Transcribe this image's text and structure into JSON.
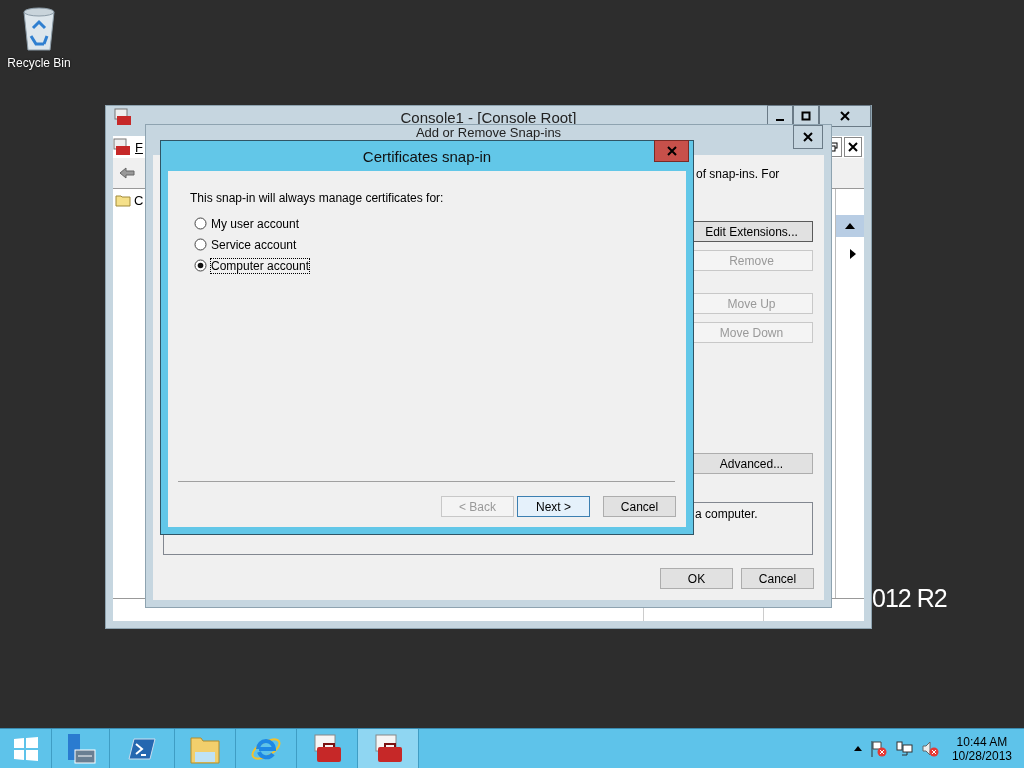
{
  "desktop": {
    "icons": [
      {
        "label": "Recycle Bin"
      }
    ],
    "watermark": "012 R2"
  },
  "console": {
    "title": "Console1 - [Console Root]",
    "menu_item": "F",
    "tree_item": "C"
  },
  "snapins_dialog": {
    "title": "Add or Remove Snap-ins",
    "intro": "of snap-ins. For",
    "buttons": [
      {
        "label": "Edit Extensions...",
        "disabled": false,
        "focused": true
      },
      {
        "label": "Remove",
        "disabled": true,
        "focused": false
      },
      {
        "label": "Move Up",
        "disabled": true,
        "focused": false
      },
      {
        "label": "Move Down",
        "disabled": true,
        "focused": false
      },
      {
        "label": "Advanced...",
        "disabled": false,
        "focused": false
      }
    ],
    "description": "a computer.",
    "footer_buttons": [
      "OK",
      "Cancel"
    ]
  },
  "cert_dialog": {
    "title": "Certificates snap-in",
    "prompt": "This snap-in will always manage certificates for:",
    "options": [
      {
        "label": "My user account",
        "selected": false
      },
      {
        "label": "Service account",
        "selected": false
      },
      {
        "label": "Computer account",
        "selected": true
      }
    ],
    "buttons": [
      {
        "label": "< Back",
        "disabled": true,
        "default": false
      },
      {
        "label": "Next >",
        "disabled": false,
        "default": true
      },
      {
        "label": "Cancel",
        "disabled": false,
        "default": false
      }
    ]
  },
  "taskbar": {
    "items": [
      {
        "kind": "start",
        "selected": false
      },
      {
        "kind": "server",
        "selected": false
      },
      {
        "kind": "shell",
        "selected": false
      },
      {
        "kind": "folder",
        "selected": false
      },
      {
        "kind": "browser",
        "selected": false
      },
      {
        "kind": "toolbox",
        "selected": false
      },
      {
        "kind": "toolbox",
        "selected": true
      }
    ],
    "clock": {
      "time": "10:44 AM",
      "date": "10/28/2013"
    }
  }
}
